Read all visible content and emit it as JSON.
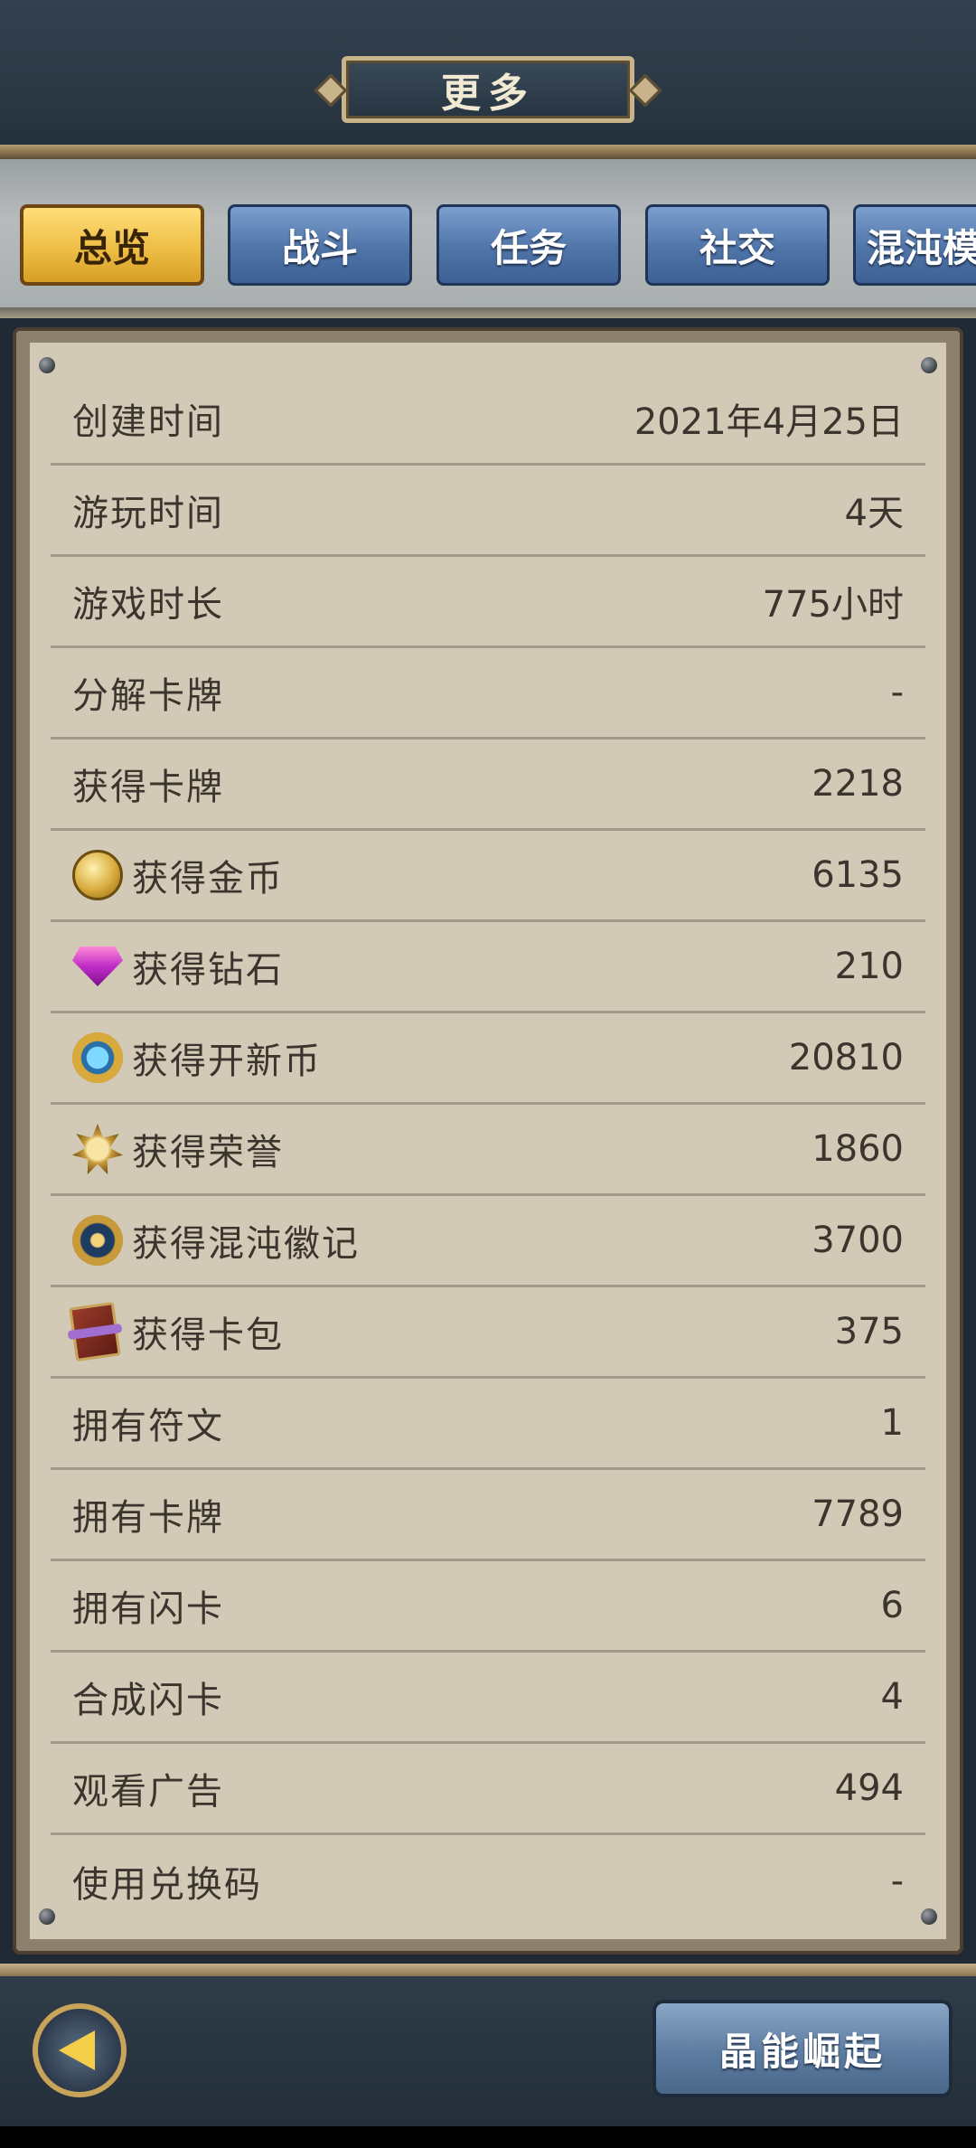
{
  "header": {
    "title": "更多"
  },
  "tabs": [
    {
      "label": "总览",
      "active": true
    },
    {
      "label": "战斗",
      "active": false
    },
    {
      "label": "任务",
      "active": false
    },
    {
      "label": "社交",
      "active": false
    },
    {
      "label": "混沌模",
      "active": false
    }
  ],
  "stats": [
    {
      "label": "创建时间",
      "value": "2021年4月25日",
      "icon": ""
    },
    {
      "label": "游玩时间",
      "value": "4天",
      "icon": ""
    },
    {
      "label": "游戏时长",
      "value": "775小时",
      "icon": ""
    },
    {
      "label": "分解卡牌",
      "value": "-",
      "icon": ""
    },
    {
      "label": "获得卡牌",
      "value": "2218",
      "icon": ""
    },
    {
      "label": "获得金币",
      "value": "6135",
      "icon": "gold-coin-icon"
    },
    {
      "label": "获得钻石",
      "value": "210",
      "icon": "diamond-icon"
    },
    {
      "label": "获得开新币",
      "value": "20810",
      "icon": "new-coin-icon"
    },
    {
      "label": "获得荣誉",
      "value": "1860",
      "icon": "honor-medal-icon"
    },
    {
      "label": "获得混沌徽记",
      "value": "3700",
      "icon": "chaos-emblem-icon"
    },
    {
      "label": "获得卡包",
      "value": "375",
      "icon": "card-pack-icon"
    },
    {
      "label": "拥有符文",
      "value": "1",
      "icon": ""
    },
    {
      "label": "拥有卡牌",
      "value": "7789",
      "icon": ""
    },
    {
      "label": "拥有闪卡",
      "value": "6",
      "icon": ""
    },
    {
      "label": "合成闪卡",
      "value": "4",
      "icon": ""
    },
    {
      "label": "观看广告",
      "value": "494",
      "icon": ""
    },
    {
      "label": "使用兑换码",
      "value": "-",
      "icon": ""
    }
  ],
  "footer": {
    "action_label": "晶能崛起"
  }
}
